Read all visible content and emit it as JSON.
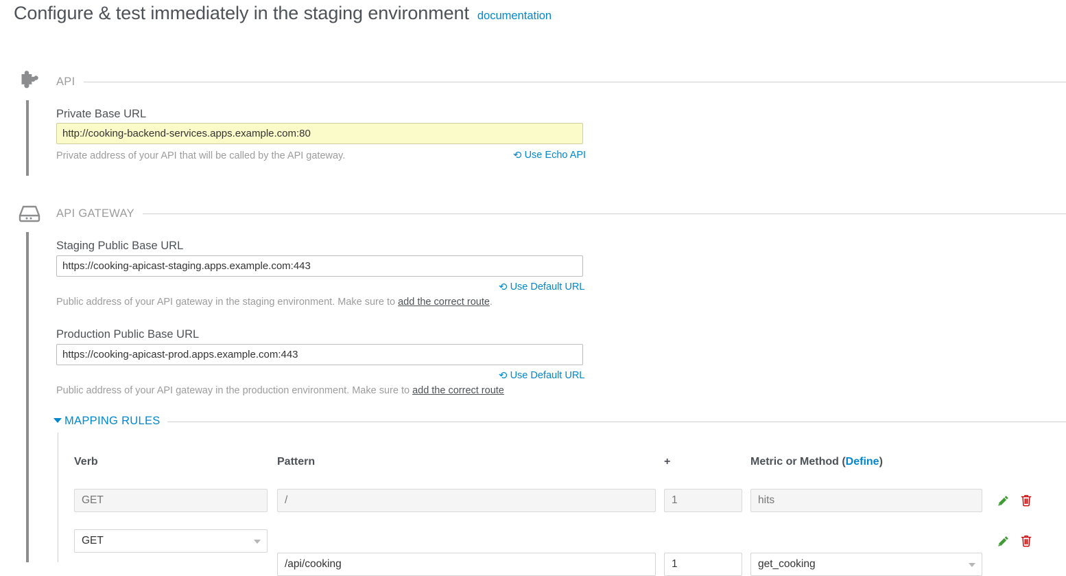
{
  "header": {
    "title": "Configure & test immediately in the staging environment",
    "documentation_link": "documentation"
  },
  "api_section": {
    "label": "API",
    "icon": "puzzle-piece-icon",
    "private_base_url": {
      "label": "Private Base URL",
      "value": "http://cooking-backend-services.apps.example.com:80",
      "help": "Private address of your API that will be called by the API gateway.",
      "reset_label": "Use Echo API",
      "reset_icon": "undo-icon"
    }
  },
  "gateway_section": {
    "label": "API GATEWAY",
    "icon": "server-icon",
    "staging": {
      "label": "Staging Public Base URL",
      "value": "https://cooking-apicast-staging.apps.example.com:443",
      "reset_label": "Use Default URL",
      "reset_icon": "undo-icon",
      "help_prefix": "Public address of your API gateway in the staging environment. Make sure to ",
      "help_link": "add the correct route",
      "help_suffix": "."
    },
    "production": {
      "label": "Production Public Base URL",
      "value": "https://cooking-apicast-prod.apps.example.com:443",
      "reset_label": "Use Default URL",
      "reset_icon": "undo-icon",
      "help_prefix": "Public address of your API gateway in the production environment. Make sure to ",
      "help_link": "add the correct route",
      "help_suffix": ""
    },
    "mapping_rules": {
      "label": "MAPPING RULES",
      "caret_icon": "caret-down-icon",
      "columns": {
        "verb": "Verb",
        "pattern": "Pattern",
        "plus": "+",
        "metric_prefix": "Metric or Method (",
        "metric_link": "Define",
        "metric_suffix": ")"
      },
      "rows": [
        {
          "verb": "GET",
          "pattern": "/",
          "delta": "1",
          "metric": "hits",
          "disabled": true,
          "edit_icon": "pencil-icon",
          "delete_icon": "trash-icon"
        },
        {
          "verb": "GET",
          "pattern": "/api/cooking",
          "delta": "1",
          "metric": "get_cooking",
          "disabled": false,
          "edit_icon": "pencil-icon",
          "delete_icon": "trash-icon"
        }
      ]
    }
  },
  "colors": {
    "link": "#0088ce",
    "title": "#4d5258",
    "muted": "#9c9c9c",
    "highlight_bg": "#fbfbca",
    "edit": "#3f9c35",
    "delete": "#cc0000"
  }
}
